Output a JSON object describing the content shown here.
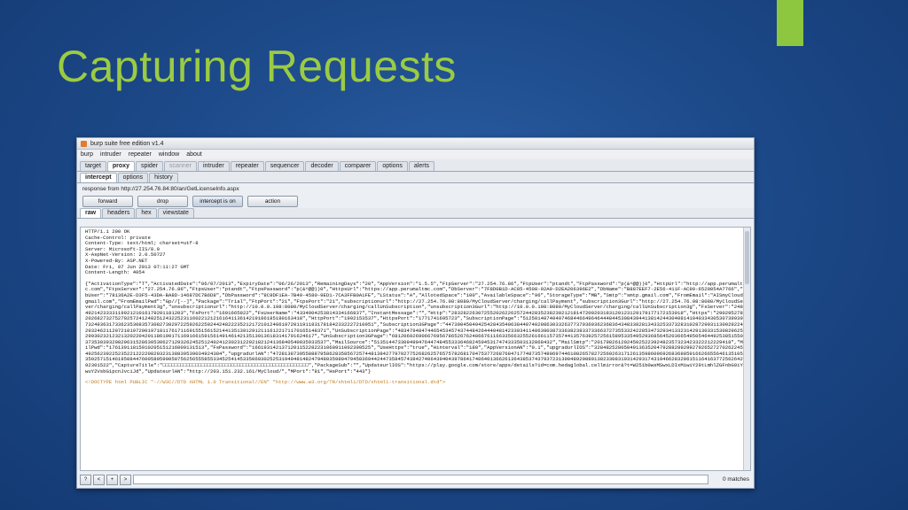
{
  "slide": {
    "title": "Capturing Requests"
  },
  "colors": {
    "title": "#9bcb43",
    "accent_bar": "#8dc63f",
    "background": "#1d4a8a"
  },
  "window": {
    "title": "burp suite free edition v1.4",
    "menu": [
      "burp",
      "intruder",
      "repeater",
      "window",
      "about"
    ],
    "tabs": [
      "target",
      "proxy",
      "spider",
      "scanner",
      "intruder",
      "repeater",
      "sequencer",
      "decoder",
      "comparer",
      "options",
      "alerts"
    ],
    "proxy_tabs": [
      "intercept",
      "options",
      "history"
    ],
    "response_info": "response from http://27.254.76.84:80/an/GetLicenseInfo.aspx",
    "buttons": {
      "forward": "forward",
      "drop": "drop",
      "intercept": "intercept is on",
      "action": "action"
    },
    "view_tabs": [
      "raw",
      "headers",
      "hex",
      "viewstate"
    ],
    "response_headers": "HTTP/1.1 200 OK\nCache-Control: private\nContent-Type: text/html; charset=utf-8\nServer: Microsoft-IIS/8.0\nX-AspNet-Version: 2.0.50727\nX-Powered-By: ASP.NET\nDate: Fri, 07 Jun 2013 07:11:27 GMT\nContent-Length: 4054",
    "response_body": "{\"ActivationType\":\"T\",\"ActivatedDate\":\"06/07/2013\",\"ExpiryDate\":\"06/26/2013\",\"RemainingDays\":\"20\",\"AppVersion\":\"1.5.5\",\"FtpServer\":\"27.254.76.86\",\"FtpUser\":\"ptandt\",\"FtpPassword\":\"p(&^@@))0\",\"HttpUrl\":\"http://app.perumaltmc.com\",\"FtpsServer\":\"27.254.76.86\",\"FtpsUser\":\"ptandt\",\"FtpsPassword\":\"p(&^@@))0\",\"HttpsUrl\":\"https://app.perumaltmc.com\",\"DbServer\":\"7F8D0B1D-AC85-4508-92A9-D2EA206396E2\",\"DbName\":\"B887EEF7-2E56-411F-AC90-6520054A7766\",\"DbUser\":\"78136A2E-D3F5-43DA-BA8D-14687DC7B6D8\",\"DbPassword\":\"8C9DF1EA-7B49-4580-9ED1-7CA3FFB0A1FE\",\"LStatus\":\"A\",\"AllotedSpace\":\"100\",\"AvailableSpace\":\"96\",\"StorageType\":\"MB\",\"Smtp\":\"smtp.gmail.com\",\"FromEmail\":\"AISmyCloud@gmail.com\",\"FromEmailPwd\":\"Gp//[--]\",\"Package\":\"Trial\",\"FtpPort\":\"21\",\"FtpsPort\":\"21\",\"subscriptionurl\":\"http://27.254.76.98:8080/MyCloudServer/charging/callPayment\",\"subscription3Gurl\":\"http://27.254.76.98:8080/MyCloudServer/charging/callPayment3g\",\"unsubscriptionurl\":\"http://10.0.0.198:8080/MyCloudServer/charging/callUnSubscription\",\"unsubscription3Gurl\":\"http://10.0.0.198:8080/MyCloudServer/charging/callUnSubscription3g\",\"FsServer\":\"2482492142333311992121016179201181203\",\"FsPort\":\"1691665922\",\"FsUserName\":\"4334004253814334166837\",\"InstantMessage\":\"\",\"Http\":\"283282263072552026226257244283523823021218147200203183120123129179177172153018\",\"Https\":\"29029527822026827327527025724124825124322523116022121216164113614219186185180163418\",\"HttpPort\":\"1992153537\",\"HttpsPort\":\"1771741695723\",\"SubscriptionPage\":\"5125014074049746844664964644484453084394413814244304081410403343053073993907324936317336235308357308273029722592622592442482223521217210124061972011911831781842332227210951\",\"Subscription3GPage\":\"44739045049425428435406384407402086303326377379369362368364348338281343325337328310287299311300292246293246211207210197200197181176171169155156152144135139129121116122171170165148371\",\"UnSubscriptionPage\":\"48347948474465453457437448426444048142339341148639038733638238337336637273553324228534732934133231429130331530829625029930232123213202204201186190171169166159156149146142135130136183141791624617\",\"UnSubscription3GPage\":\"68120692690667695678652676248667611663356632552616611573574413576392572561589533549529368564520366549505464492538515501373530393298296315286305306271293262452512402412302312292182124136840540035933537\",\"MailSource\":\"513514473309490476447484553336468245945317474333503132868432\",\"MailSmtp\":\"2017982612024502522392482357323423322212229418\",\"MailPwd\":\"17613911815910205151216009131513\",\"FsPassword\":\"1661931421371201152282231060911002390525\",\"UseHttps\":\"true\",\"Hinterval\":\"180\",\"AppVersionAN\":\"0.1\",\"upgradurlIOS\":\"3284825280504913635204792882892992792652727026224524925623922523522122220820323138839539034924384\",\"upgradurlAN\":\"47281387395588879586283585672574481384277970277526826257657578268170475377268768471774873574806974461082657827256926317126135986096926836885916626655646135105135025715146195084476005895900587562565558553345254145335060302525319494814824794803598047945036944244735845743842740643940439786417406401366261364385374379372313904892008913823308319314293174319466283286151164163772562642592301522\",\"CaptureTitle\":\"□□□□□□□□□□□□□□□□□□□□□□□□□□□□□□□□□□□□□□□□□□□□□□□□□\",\"PackageSub\":\"\",\"UpdateurlIOS\":\"https://play.google.com/store/apps/details?id=com.hedaglobal.cellmirror&?t=W251b0wsMSwxLDIxMiwiY29tLmhlZGFnbG9iYWwuY2VsbG1pcnJvciJd\",\"UpdateurlAN\":\"http://203.151.232.161/MyCloud/\",\"MPort\":\"81\",\"HsPort\":\"443\"}",
    "response_html": "<!DOCTYPE html PUBLIC \"-//W3C//DTD XHTML 1.0 Transitional//EN\" \"http://www.w3.org/TR/xhtml1/DTD/xhtml1-transitional.dtd\">",
    "search": {
      "buttons": [
        "?",
        "<",
        "+",
        ">"
      ],
      "value": "",
      "matches": "0 matches"
    }
  }
}
